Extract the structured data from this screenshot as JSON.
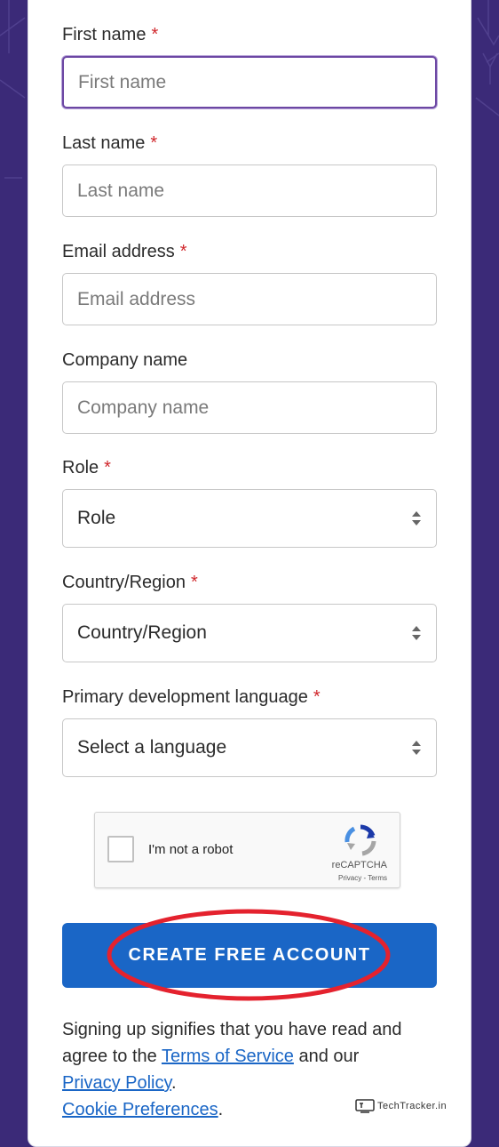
{
  "colors": {
    "background": "#3b2a78",
    "accent": "#1a66c6",
    "required": "#d0262b",
    "focus": "#6c47a3"
  },
  "form": {
    "first_name": {
      "label": "First name",
      "required_mark": "*",
      "placeholder": "First name",
      "value": ""
    },
    "last_name": {
      "label": "Last name",
      "required_mark": "*",
      "placeholder": "Last name",
      "value": ""
    },
    "email": {
      "label": "Email address",
      "required_mark": "*",
      "placeholder": "Email address",
      "value": ""
    },
    "company": {
      "label": "Company name",
      "placeholder": "Company name",
      "value": ""
    },
    "role": {
      "label": "Role",
      "required_mark": "*",
      "selected": "Role"
    },
    "country": {
      "label": "Country/Region",
      "required_mark": "*",
      "selected": "Country/Region"
    },
    "language": {
      "label": "Primary development language",
      "required_mark": "*",
      "selected": "Select a language"
    }
  },
  "recaptcha": {
    "label": "I'm not a robot",
    "brand": "reCAPTCHA",
    "privacy": "Privacy",
    "separator": " - ",
    "terms": "Terms",
    "checked": false
  },
  "cta": {
    "label": "CREATE FREE ACCOUNT"
  },
  "legal": {
    "text1": "Signing up signifies that you have read and agree to the ",
    "terms_link": "Terms of Service",
    "text2": " and our ",
    "privacy_link": "Privacy Policy",
    "text3": ".",
    "cookie_link": "Cookie Preferences",
    "text4": "."
  },
  "watermark": {
    "text": "TechTracker.in"
  }
}
